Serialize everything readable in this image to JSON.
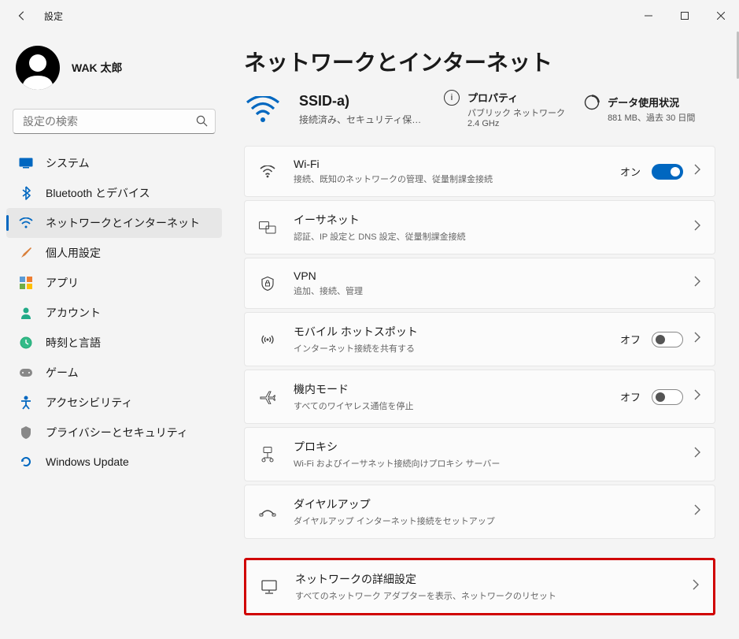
{
  "window": {
    "title": "設定"
  },
  "user": {
    "name": "WAK  太郎"
  },
  "search": {
    "placeholder": "設定の検索"
  },
  "nav": {
    "system": "システム",
    "bluetooth": "Bluetooth とデバイス",
    "network": "ネットワークとインターネット",
    "personalization": "個人用設定",
    "apps": "アプリ",
    "accounts": "アカウント",
    "time": "時刻と言語",
    "gaming": "ゲーム",
    "accessibility": "アクセシビリティ",
    "privacy": "プライバシーとセキュリティ",
    "update": "Windows Update"
  },
  "page": {
    "title": "ネットワークとインターネット",
    "status": {
      "ssid": "SSID-a)",
      "ssid_sub": "接続済み、セキュリティ保護あり",
      "properties": {
        "title": "プロパティ",
        "sub": "パブリック ネットワーク\n2.4 GHz"
      },
      "data": {
        "title": "データ使用状況",
        "sub": "881 MB、過去 30 日間"
      }
    },
    "items": {
      "wifi": {
        "title": "Wi-Fi",
        "sub": "接続、既知のネットワークの管理、従量制課金接続",
        "state": "オン"
      },
      "ethernet": {
        "title": "イーサネット",
        "sub": "認証、IP 設定と DNS 設定、従量制課金接続"
      },
      "vpn": {
        "title": "VPN",
        "sub": "追加、接続、管理"
      },
      "hotspot": {
        "title": "モバイル ホットスポット",
        "sub": "インターネット接続を共有する",
        "state": "オフ"
      },
      "airplane": {
        "title": "機内モード",
        "sub": "すべてのワイヤレス通信を停止",
        "state": "オフ"
      },
      "proxy": {
        "title": "プロキシ",
        "sub": "Wi-Fi およびイーサネット接続向けプロキシ サーバー"
      },
      "dialup": {
        "title": "ダイヤルアップ",
        "sub": "ダイヤルアップ インターネット接続をセットアップ"
      },
      "advanced": {
        "title": "ネットワークの詳細設定",
        "sub": "すべてのネットワーク アダプターを表示、ネットワークのリセット"
      }
    }
  }
}
